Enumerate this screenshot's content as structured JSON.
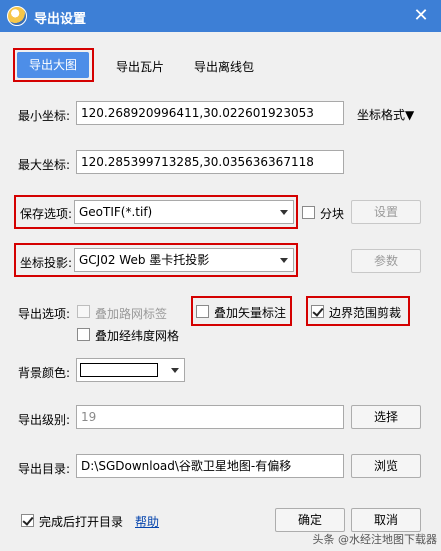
{
  "titlebar": {
    "title": "导出设置",
    "close": "✕"
  },
  "tabs": [
    {
      "label": "导出大图"
    },
    {
      "label": "导出瓦片"
    },
    {
      "label": "导出离线包"
    }
  ],
  "min_coord": {
    "label": "最小坐标:",
    "value": "120.268920996411,30.022601923053"
  },
  "max_coord": {
    "label": "最大坐标:",
    "value": "120.285399713285,30.035636367118"
  },
  "coord_format": {
    "label": "坐标格式▼"
  },
  "save_option": {
    "label": "保存选项:",
    "value": "GeoTIF(*.tif)"
  },
  "tile_split": {
    "label": "分块",
    "checked": false
  },
  "settings_button": {
    "label": "设置"
  },
  "projection": {
    "label": "坐标投影:",
    "value": "GCJ02 Web 墨卡托投影"
  },
  "params_button": {
    "label": "参数"
  },
  "export_options": {
    "label": "导出选项:",
    "road_labels": "叠加路网标签",
    "vector_labels": "叠加矢量标注",
    "boundary_clip": "边界范围剪裁",
    "graticule": "叠加经纬度网格"
  },
  "background": {
    "label": "背景颜色:",
    "color": "#ffffff"
  },
  "export_level": {
    "label": "导出级别:",
    "value": "19"
  },
  "select_button": {
    "label": "选择"
  },
  "export_dir": {
    "label": "导出目录:",
    "value": "D:\\SGDownload\\谷歌卫星地图-有偏移"
  },
  "browse_button": {
    "label": "浏览"
  },
  "open_after": {
    "label": "完成后打开目录",
    "checked": true
  },
  "help_link": {
    "label": "帮助"
  },
  "ok_button": {
    "label": "确定"
  },
  "cancel_button": {
    "label": "取消"
  },
  "watermark": {
    "text": "头条 @水经注地图下载器"
  },
  "colors": {
    "accent": "#4d8ee8",
    "titlebar": "#3d7fd6",
    "highlight": "#d40000"
  }
}
